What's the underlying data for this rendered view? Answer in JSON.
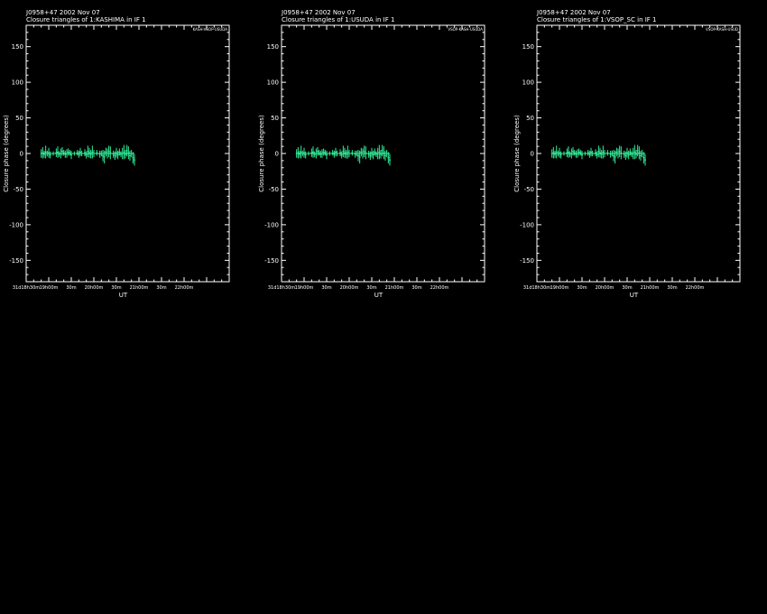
{
  "panels": [
    {
      "header1": "J0958+47  2002 Nov 07",
      "header2": "Closure triangles of 1:KASHIMA in IF 1",
      "triangle": "KASH-VSOP-USUDA"
    },
    {
      "header1": "J0958+47  2002 Nov 07",
      "header2": "Closure triangles of 1:USUDA in IF 1",
      "triangle": "VSOP-KASH-USUDA"
    },
    {
      "header1": "J0958+47  2002 Nov 07",
      "header2": "Closure triangles of 1:VSOP_SC in IF 1",
      "triangle": "VSOP-KASH-USUD"
    }
  ],
  "chart_data": {
    "type": "scatter",
    "ylabel": "Closure phase  (degrees)",
    "xlabel": "UT",
    "ylim": [
      -180,
      180
    ],
    "yticks": [
      -150,
      -100,
      -50,
      0,
      50,
      100,
      150
    ],
    "xlim_minutes": [
      1080,
      1350
    ],
    "xticks": [
      {
        "minutes": 1080,
        "label": "31d18h30m"
      },
      {
        "minutes": 1110,
        "label": "19h00m"
      },
      {
        "minutes": 1140,
        "label": "30m"
      },
      {
        "minutes": 1170,
        "label": "20h00m"
      },
      {
        "minutes": 1200,
        "label": "30m"
      },
      {
        "minutes": 1230,
        "label": "21h00m"
      },
      {
        "minutes": 1260,
        "label": "30m"
      },
      {
        "minutes": 1290,
        "label": "22h00m"
      }
    ],
    "color": "#33ee99",
    "series": [
      {
        "points": [
          {
            "t": 1100,
            "y": 0,
            "e": 6
          },
          {
            "t": 1102,
            "y": 1,
            "e": 8
          },
          {
            "t": 1104,
            "y": -1,
            "e": 5
          },
          {
            "t": 1106,
            "y": 2,
            "e": 9
          },
          {
            "t": 1108,
            "y": 0,
            "e": 4
          },
          {
            "t": 1110,
            "y": 1,
            "e": 7
          },
          {
            "t": 1112,
            "y": -2,
            "e": 5
          },
          {
            "t": 1116,
            "y": 0,
            "e": 3
          },
          {
            "t": 1120,
            "y": 1,
            "e": 6
          },
          {
            "t": 1122,
            "y": 2,
            "e": 8
          },
          {
            "t": 1124,
            "y": -1,
            "e": 4
          },
          {
            "t": 1126,
            "y": 0,
            "e": 7
          },
          {
            "t": 1128,
            "y": 3,
            "e": 6
          },
          {
            "t": 1130,
            "y": 1,
            "e": 4
          },
          {
            "t": 1132,
            "y": -1,
            "e": 5
          },
          {
            "t": 1134,
            "y": 0,
            "e": 6
          },
          {
            "t": 1136,
            "y": 2,
            "e": 5
          },
          {
            "t": 1138,
            "y": 1,
            "e": 4
          },
          {
            "t": 1140,
            "y": -2,
            "e": 6
          },
          {
            "t": 1144,
            "y": 0,
            "e": 3
          },
          {
            "t": 1148,
            "y": 1,
            "e": 4
          },
          {
            "t": 1150,
            "y": -1,
            "e": 5
          },
          {
            "t": 1152,
            "y": 2,
            "e": 6
          },
          {
            "t": 1154,
            "y": 0,
            "e": 4
          },
          {
            "t": 1158,
            "y": 1,
            "e": 5
          },
          {
            "t": 1160,
            "y": -2,
            "e": 5
          },
          {
            "t": 1162,
            "y": 3,
            "e": 8
          },
          {
            "t": 1164,
            "y": 1,
            "e": 7
          },
          {
            "t": 1166,
            "y": -1,
            "e": 6
          },
          {
            "t": 1168,
            "y": 2,
            "e": 9
          },
          {
            "t": 1170,
            "y": 0,
            "e": 5
          },
          {
            "t": 1174,
            "y": 1,
            "e": 4
          },
          {
            "t": 1178,
            "y": -1,
            "e": 5
          },
          {
            "t": 1180,
            "y": 0,
            "e": 4
          },
          {
            "t": 1182,
            "y": -3,
            "e": 8
          },
          {
            "t": 1184,
            "y": -5,
            "e": 9
          },
          {
            "t": 1186,
            "y": 2,
            "e": 6
          },
          {
            "t": 1188,
            "y": 0,
            "e": 7
          },
          {
            "t": 1190,
            "y": 3,
            "e": 8
          },
          {
            "t": 1192,
            "y": 1,
            "e": 9
          },
          {
            "t": 1196,
            "y": -1,
            "e": 5
          },
          {
            "t": 1198,
            "y": -3,
            "e": 6
          },
          {
            "t": 1200,
            "y": 1,
            "e": 7
          },
          {
            "t": 1202,
            "y": -2,
            "e": 6
          },
          {
            "t": 1204,
            "y": 2,
            "e": 5
          },
          {
            "t": 1206,
            "y": -1,
            "e": 4
          },
          {
            "t": 1208,
            "y": 0,
            "e": 8
          },
          {
            "t": 1210,
            "y": 2,
            "e": 10
          },
          {
            "t": 1212,
            "y": -1,
            "e": 6
          },
          {
            "t": 1214,
            "y": 4,
            "e": 8
          },
          {
            "t": 1216,
            "y": 1,
            "e": 9
          },
          {
            "t": 1218,
            "y": -3,
            "e": 7
          },
          {
            "t": 1220,
            "y": 0,
            "e": 5
          },
          {
            "t": 1222,
            "y": -6,
            "e": 8
          },
          {
            "t": 1224,
            "y": -9,
            "e": 8
          }
        ]
      }
    ]
  }
}
